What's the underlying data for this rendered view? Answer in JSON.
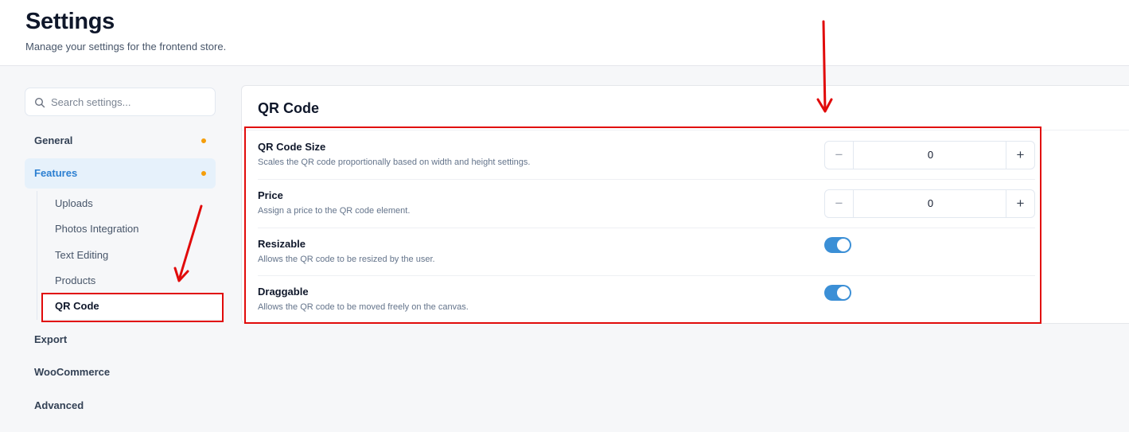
{
  "header": {
    "title": "Settings",
    "subtitle": "Manage your settings for the frontend store."
  },
  "sidebar": {
    "search_placeholder": "Search settings...",
    "items": [
      {
        "label": "General",
        "has_dot": true
      },
      {
        "label": "Features",
        "has_dot": true,
        "active": true
      },
      {
        "label": "Export"
      },
      {
        "label": "WooCommerce"
      },
      {
        "label": "Advanced"
      }
    ],
    "subitems": [
      {
        "label": "Uploads"
      },
      {
        "label": "Photos Integration"
      },
      {
        "label": "Text Editing"
      },
      {
        "label": "Products"
      },
      {
        "label": "QR Code",
        "active": true
      }
    ]
  },
  "panel": {
    "title": "QR Code",
    "settings": [
      {
        "label": "QR Code Size",
        "description": "Scales the QR code proportionally based on width and height settings.",
        "control": "stepper",
        "value": "0",
        "minus": "−",
        "plus": "+"
      },
      {
        "label": "Price",
        "description": "Assign a price to the QR code element.",
        "control": "stepper",
        "value": "0",
        "minus": "−",
        "plus": "+"
      },
      {
        "label": "Resizable",
        "description": "Allows the QR code to be resized by the user.",
        "control": "toggle",
        "on": true
      },
      {
        "label": "Draggable",
        "description": "Allows the QR code to be moved freely on the canvas.",
        "control": "toggle",
        "on": true
      }
    ]
  },
  "colors": {
    "accent": "#3b8fd6",
    "active_nav_bg": "#e6f1fb",
    "dot": "#f59e0b",
    "annotation": "#e10b0b"
  }
}
